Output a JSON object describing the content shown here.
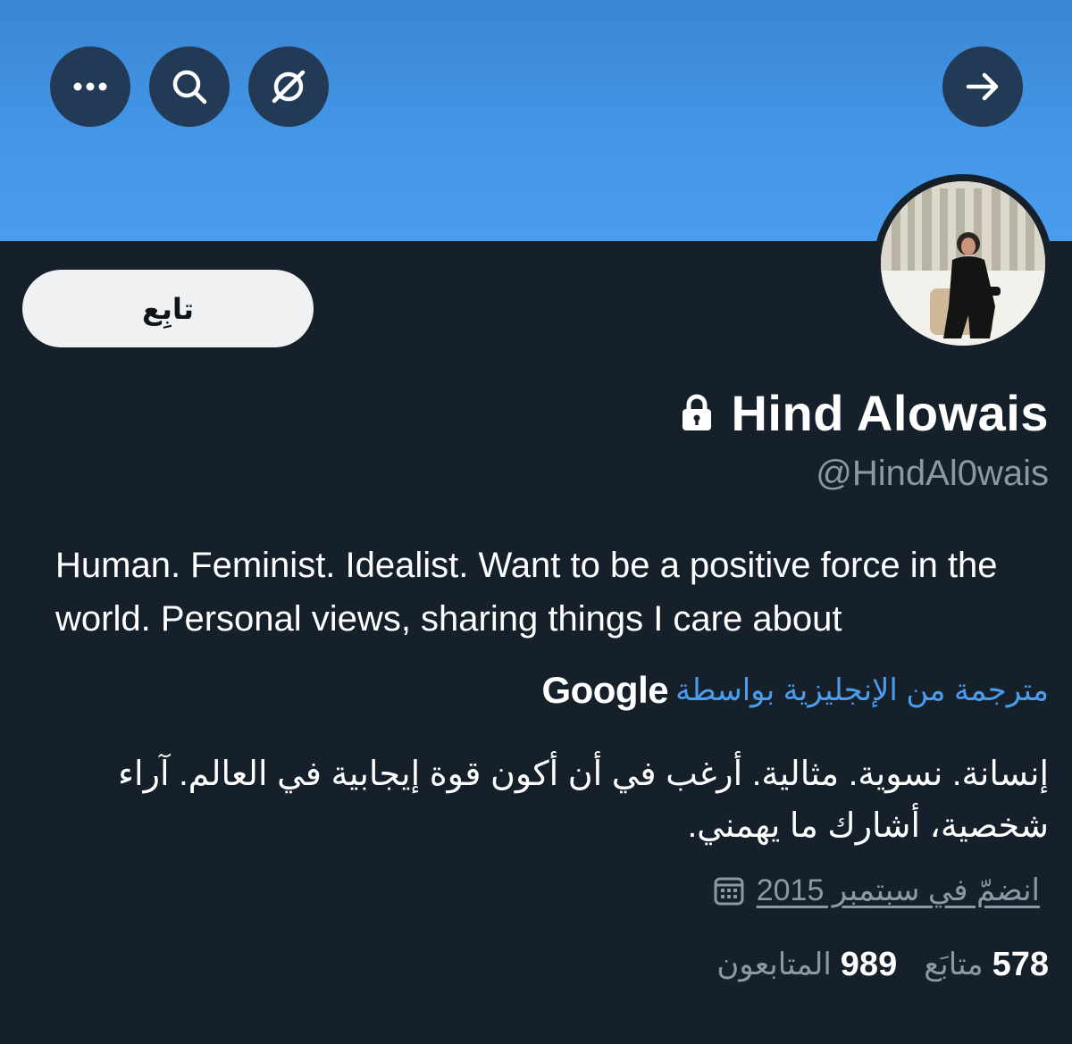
{
  "header": {
    "more_icon": "more-horizontal-icon",
    "search_icon": "search-icon",
    "grok_icon": "slashed-circle-icon",
    "back_icon": "arrow-right-icon"
  },
  "profile": {
    "follow_label": "تابِع",
    "display_name": "Hind Alowais",
    "protected_icon": "lock-icon",
    "handle": "@HindAl0wais",
    "bio_en": "Human. Feminist. Idealist. Want to be a positive force in the world. Personal views, sharing things I care about",
    "translated_by": "مترجمة من الإنجليزية بواسطة",
    "translator": "Google",
    "bio_ar": "إنسانة. نسوية. مثالية. أرغب في أن أكون قوة إيجابية في العالم. آراء شخصية، أشارك ما يهمني.",
    "joined": "انضمّ في سبتمبر 2015",
    "calendar_icon": "calendar-icon"
  },
  "stats": {
    "following_count": "578",
    "following_label": "متابَع",
    "followers_count": "989",
    "followers_label": "المتابعون"
  },
  "colors": {
    "background": "#15202b",
    "banner": "#4497e8",
    "accent_blue": "#4a9cec",
    "muted_text": "#8b98a5",
    "button_bg": "#223a55"
  }
}
